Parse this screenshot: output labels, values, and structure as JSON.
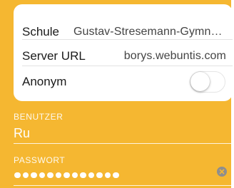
{
  "settings": {
    "school_label": "Schule",
    "school_value": "Gustav-Stresemann-Gymnasium",
    "server_label": "Server URL",
    "server_value": "borys.webuntis.com",
    "anonymous_label": "Anonym",
    "anonymous_enabled": false
  },
  "username": {
    "label": "BENUTZER",
    "value": "Ru"
  },
  "password": {
    "label": "PASSWORT",
    "masked_length": 13
  },
  "icons": {
    "clear": "clear-icon"
  },
  "colors": {
    "background": "#F5B731",
    "card": "#FFFFFF",
    "text_on_background": "#FFFFFF"
  }
}
